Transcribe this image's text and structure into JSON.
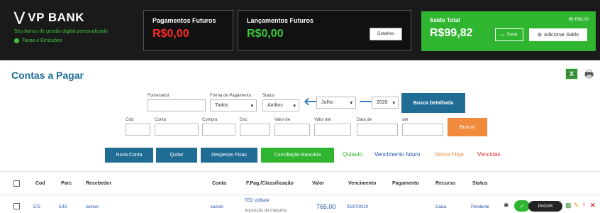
{
  "brand": {
    "name": "VP BANK",
    "tagline": "Seu banco de gestão digital personalizado",
    "link": "Taxas e Emissões"
  },
  "panels": {
    "pagamentos": {
      "label": "Pagamentos Futuros",
      "value": "R$0,00"
    },
    "lancamentos": {
      "label": "Lançamentos Futuros",
      "value": "R$0,00",
      "details_button": "Detalhes"
    },
    "saldo": {
      "label": "Saldo Total",
      "value": "R$99,82",
      "eye_text": "👁 R$0,00",
      "sacar_button": "Sacar",
      "add_button": "Adicionar Saldo"
    }
  },
  "page_title": "Contas a Pagar",
  "filters": {
    "fornecedor_label": "Fornecedor",
    "forma_pagamento_label": "Forma de Pagamento",
    "forma_pagamento_value": "Todos",
    "status_label": "Status",
    "status_value": "Ambos",
    "month_value": "Julho",
    "year_value": "2020",
    "busca_detalhada_button": "Busca Detalhada",
    "cod_label": "Cód",
    "conta_label": "Conta",
    "compra_label": "Compra",
    "doc_label": "Doc",
    "valor_de_label": "Valor de",
    "valor_ate_label": "Valor até",
    "data_de_label": "Data de",
    "ate_label": "até",
    "buscar_button": "Buscar"
  },
  "actions": {
    "nova_conta": "Nova Conta",
    "quitar": "Quitar",
    "despesas_fixas": "Despesas Fixas",
    "conciliacao": "Conciliação Bancária"
  },
  "status_filters": {
    "quitado": "Quitado",
    "vencimento_futuro": "Vencimento futuro",
    "vence_hoje": "Vence Hoje",
    "vencidas": "Vencidas"
  },
  "colors": {
    "quitado": "#2fb52f",
    "vencimento_futuro": "#1f4ea8",
    "vence_hoje": "#f08a3c",
    "vencidas": "#e0262f"
  },
  "table": {
    "headers": {
      "cod": "Cod",
      "parc": "Parc",
      "recebedor": "Recebedor",
      "conta": "Conta",
      "fpag": "F.Pag./Classificação",
      "valor": "Valor",
      "vencimento": "Vencimento",
      "pagamento": "Pagamento",
      "recurso": "Recurso",
      "status": "Status"
    },
    "rows": [
      {
        "cod": "572",
        "parc": "5/10",
        "recebedor": "kumon",
        "conta": "kumon",
        "fpag": "TED VpBank",
        "classificacao": "Aquisição de máquina",
        "valor": "765,00",
        "vencimento": "02/07/2020",
        "pagamento": "",
        "recurso": "Caixa",
        "status": "Pendente",
        "pay_button": "PAGAR"
      }
    ]
  }
}
